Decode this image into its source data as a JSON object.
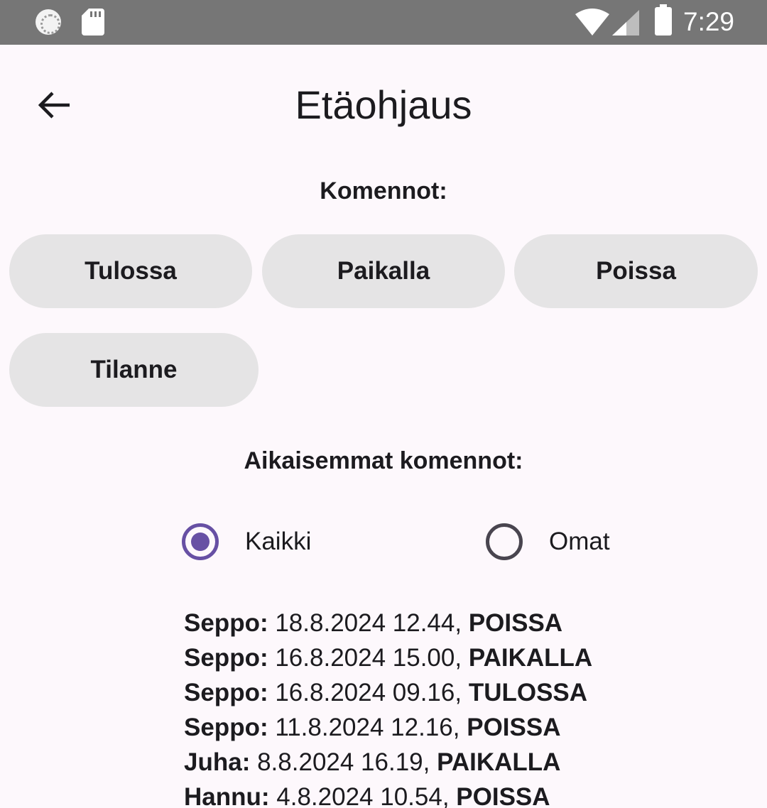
{
  "status_bar": {
    "time": "7:29",
    "icons": [
      "sync-icon",
      "sd-card-icon",
      "wifi-icon",
      "signal-icon",
      "battery-icon"
    ]
  },
  "header": {
    "title": "Etäohjaus",
    "back_icon": "arrow-back-icon"
  },
  "commands": {
    "label": "Komennot:",
    "buttons": [
      "Tulossa",
      "Paikalla",
      "Poissa",
      "Tilanne"
    ]
  },
  "history": {
    "label": "Aikaisemmat komennot:",
    "filter": {
      "options": [
        "Kaikki",
        "Omat"
      ],
      "selected": "Kaikki"
    },
    "entries": [
      {
        "user": "Seppo:",
        "datetime": "18.8.2024 12.44,",
        "status": "POISSA"
      },
      {
        "user": "Seppo:",
        "datetime": "16.8.2024 15.00,",
        "status": "PAIKALLA"
      },
      {
        "user": "Seppo:",
        "datetime": "16.8.2024 09.16,",
        "status": "TULOSSA"
      },
      {
        "user": "Seppo:",
        "datetime": "11.8.2024 12.16,",
        "status": "POISSA"
      },
      {
        "user": "Juha:",
        "datetime": "8.8.2024 16.19,",
        "status": "PAIKALLA"
      },
      {
        "user": "Hannu:",
        "datetime": "4.8.2024 10.54,",
        "status": "POISSA"
      }
    ]
  },
  "colors": {
    "status_bar": "#767676",
    "background": "#fdf8fc",
    "button_bg": "#e5e4e5",
    "accent": "#6750a4"
  }
}
